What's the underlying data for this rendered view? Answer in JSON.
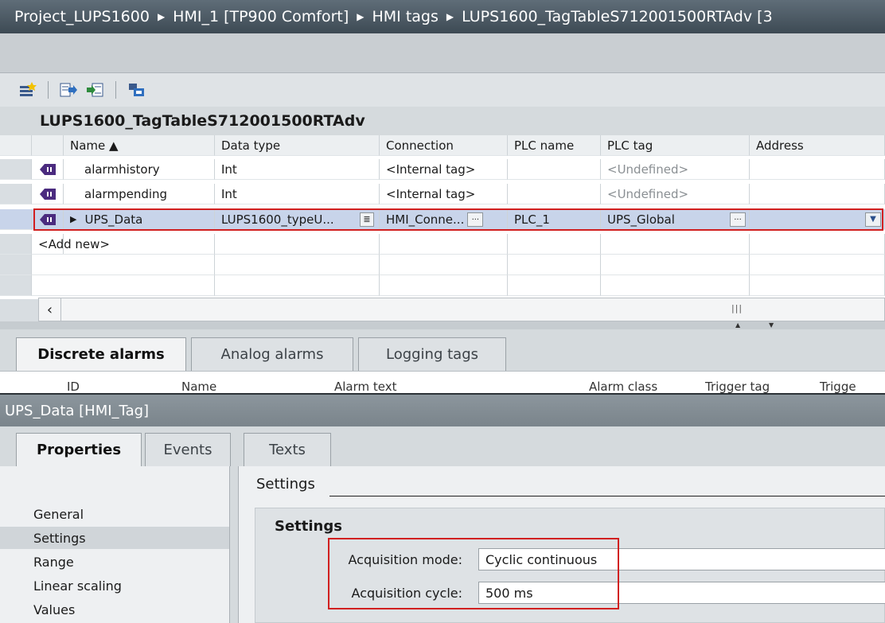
{
  "breadcrumb": {
    "items": [
      "Project_LUPS1600",
      "HMI_1 [TP900 Comfort]",
      "HMI tags",
      "LUPS1600_TagTableS712001500RTAdv [3"
    ],
    "separator": "▶"
  },
  "toolbar": {
    "buttons": [
      "add-tag-icon",
      "export-icon",
      "import-icon",
      "tag-properties-icon"
    ]
  },
  "table": {
    "title": "LUPS1600_TagTableS712001500RTAdv",
    "columns": [
      "Name ▲",
      "Data type",
      "Connection",
      "PLC name",
      "PLC tag",
      "Address"
    ],
    "rows": [
      {
        "name": "alarmhistory",
        "data_type": "Int",
        "connection": "<Internal tag>",
        "plc_name": "",
        "plc_tag": "<Undefined>",
        "address": ""
      },
      {
        "name": "alarmpending",
        "data_type": "Int",
        "connection": "<Internal tag>",
        "plc_name": "",
        "plc_tag": "<Undefined>",
        "address": ""
      },
      {
        "name": "UPS_Data",
        "data_type": "LUPS1600_typeU...",
        "connection": "HMI_Conne...",
        "plc_name": "PLC_1",
        "plc_tag": "UPS_Global",
        "address": ""
      }
    ],
    "add_new": "<Add new>",
    "ellipsis": "..."
  },
  "alarm_tabs": [
    "Discrete alarms",
    "Analog alarms",
    "Logging tags"
  ],
  "alarm_columns": [
    "ID",
    "Name",
    "Alarm text",
    "Alarm class",
    "Trigger tag",
    "Trigge"
  ],
  "inspector": {
    "title": "UPS_Data [HMI_Tag]",
    "tabs": [
      "Properties",
      "Events",
      "Texts"
    ],
    "nav": [
      "General",
      "Settings",
      "Range",
      "Linear scaling",
      "Values"
    ],
    "section_heading": "Settings",
    "group_title": "Settings",
    "acquisition_mode_label": "Acquisition mode:",
    "acquisition_mode_value": "Cyclic continuous",
    "acquisition_cycle_label": "Acquisition cycle:",
    "acquisition_cycle_value": "500 ms"
  },
  "colors": {
    "highlight": "#d12020",
    "selection": "#c8d4ea",
    "header_dark": "#3d4a54",
    "tag_icon": "#4b2b7f"
  }
}
